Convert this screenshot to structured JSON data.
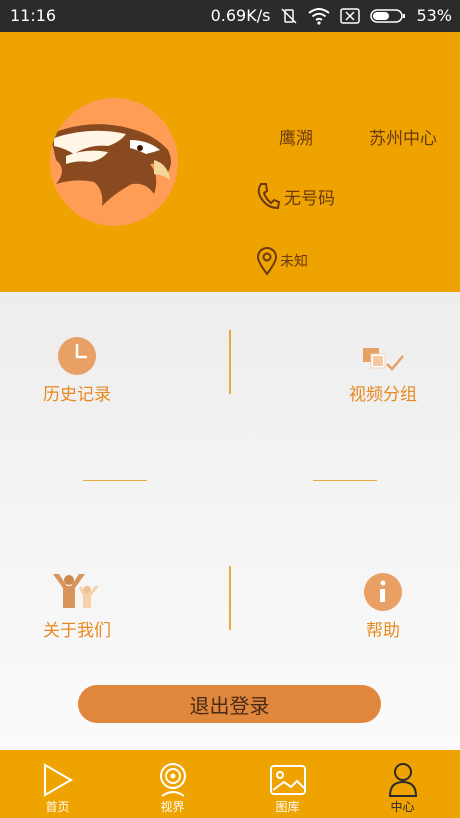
{
  "status": {
    "time": "11:16",
    "speed": "0.69K/s",
    "battery_pct": "53%"
  },
  "profile": {
    "nickname": "鹰溯",
    "center_label": "苏州中心",
    "phone": "无号码",
    "location": "未知"
  },
  "menu": {
    "history": "历史记录",
    "video_group": "视频分组",
    "about": "关于我们",
    "help": "帮助"
  },
  "logout_label": "退出登录",
  "tabs": [
    {
      "label": "首页",
      "icon": "play-icon"
    },
    {
      "label": "视界",
      "icon": "camera-icon"
    },
    {
      "label": "图库",
      "icon": "gallery-icon"
    },
    {
      "label": "中心",
      "icon": "user-icon"
    }
  ],
  "colors": {
    "primary": "#efa300",
    "accent": "#e88820",
    "logout_bg": "#e0873e"
  }
}
